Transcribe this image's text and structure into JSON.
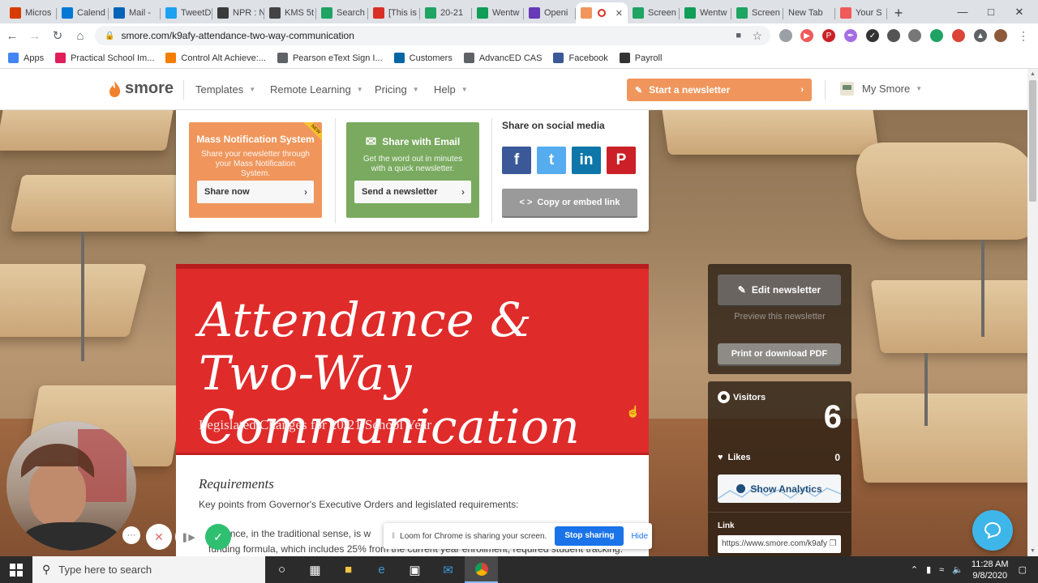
{
  "browser": {
    "tabs": [
      {
        "label": "Micros",
        "icon": "office-icon",
        "color": "#d83b01"
      },
      {
        "label": "Calend",
        "icon": "calendar-icon",
        "color": "#0078d4"
      },
      {
        "label": "Mail -",
        "icon": "outlook-icon",
        "color": "#0364b8"
      },
      {
        "label": "TweetD",
        "icon": "twitter-icon",
        "color": "#1da1f2"
      },
      {
        "label": "NPR : N",
        "icon": "npr-icon",
        "color": "#3a3a3a"
      },
      {
        "label": "KMS 5t",
        "icon": "kms-icon",
        "color": "#444444"
      },
      {
        "label": "Search",
        "icon": "drive-icon",
        "color": "#1fa463"
      },
      {
        "label": "[This is",
        "icon": "gmail-icon",
        "color": "#d93025"
      },
      {
        "label": "20-21",
        "icon": "drive-icon",
        "color": "#1fa463"
      },
      {
        "label": "Wentw",
        "icon": "sheets-icon",
        "color": "#0f9d58"
      },
      {
        "label": "Openi",
        "icon": "forms-icon",
        "color": "#673ab7"
      },
      {
        "label": "",
        "icon": "smore-icon",
        "color": "#f0965c",
        "active": true
      },
      {
        "label": "Screen",
        "icon": "drive-icon",
        "color": "#1fa463"
      },
      {
        "label": "Wentw",
        "icon": "sheets-icon",
        "color": "#0f9d58"
      },
      {
        "label": "Screen",
        "icon": "drive-icon",
        "color": "#1fa463"
      },
      {
        "label": "New Tab",
        "icon": "",
        "color": "#dee1e6"
      },
      {
        "label": "Your S",
        "icon": "loom-icon",
        "color": "#f05a5a"
      }
    ],
    "url": "smore.com/k9afy-attendance-two-way-communication",
    "bookmarks": [
      {
        "label": "Apps",
        "icon": "apps-icon",
        "color": "#4285f4"
      },
      {
        "label": "Practical School Im...",
        "icon": "slack-icon",
        "color": "#e01e5a"
      },
      {
        "label": "Control Alt Achieve:...",
        "icon": "blogger-icon",
        "color": "#f57d00"
      },
      {
        "label": "Pearson eText Sign I...",
        "icon": "globe-icon",
        "color": "#5f6368"
      },
      {
        "label": "Customers",
        "icon": "powerschool-icon",
        "color": "#0066a4"
      },
      {
        "label": "AdvancED CAS",
        "icon": "globe-icon",
        "color": "#5f6368"
      },
      {
        "label": "Facebook",
        "icon": "facebook-icon",
        "color": "#3b5998"
      },
      {
        "label": "Payroll",
        "icon": "workday-icon",
        "color": "#333333"
      }
    ]
  },
  "smore": {
    "logo_text": "smore",
    "nav": {
      "templates": "Templates",
      "remote_learning": "Remote Learning",
      "pricing": "Pricing",
      "help": "Help"
    },
    "start_newsletter": "Start a newsletter",
    "my_smore": "My Smore"
  },
  "share": {
    "mass": {
      "title": "Mass Notification System",
      "badge": "NEW",
      "description": "Share your newsletter through your Mass Notification System.",
      "button": "Share now",
      "color": "#f0965c"
    },
    "email": {
      "title": "Share with Email",
      "description": "Get the word out in minutes with a quick newsletter.",
      "button": "Send a newsletter",
      "color": "#79aa5f"
    },
    "social_title": "Share on social media",
    "social": [
      {
        "name": "facebook-button",
        "glyph": "f",
        "color": "#3b5998"
      },
      {
        "name": "twitter-button",
        "glyph": "t",
        "color": "#55acee"
      },
      {
        "name": "linkedin-button",
        "glyph": "in",
        "color": "#0e76a8"
      },
      {
        "name": "pinterest-button",
        "glyph": "P",
        "color": "#cb2027"
      }
    ],
    "embed": "Copy or embed link"
  },
  "newsletter": {
    "title": "Attendance & Two-Way Communication",
    "subtitle": "Legislated Changes for 20/21 School Year",
    "section_title": "Requirements",
    "intro": "Key points from Governor's Executive Orders and legislated requirements:",
    "bullets": [
      "endance, in the traditional sense, is w",
      "funding formula, which includes 25% from the current year enrollment; required student tracking."
    ]
  },
  "sidebar": {
    "edit": "Edit newsletter",
    "preview": "Preview this newsletter",
    "pdf": "Print or download PDF",
    "visitors_label": "Visitors",
    "visitors_count": "6",
    "likes_label": "Likes",
    "likes_count": "0",
    "analytics": "Show Analytics",
    "link_label": "Link",
    "link_value": "https://www.smore.com/k9afy"
  },
  "loom": {
    "message": "Loom for Chrome is sharing your screen.",
    "stop": "Stop sharing",
    "hide": "Hide"
  },
  "taskbar": {
    "search_placeholder": "Type here to search",
    "time": "11:28 AM",
    "date": "9/8/2020"
  }
}
